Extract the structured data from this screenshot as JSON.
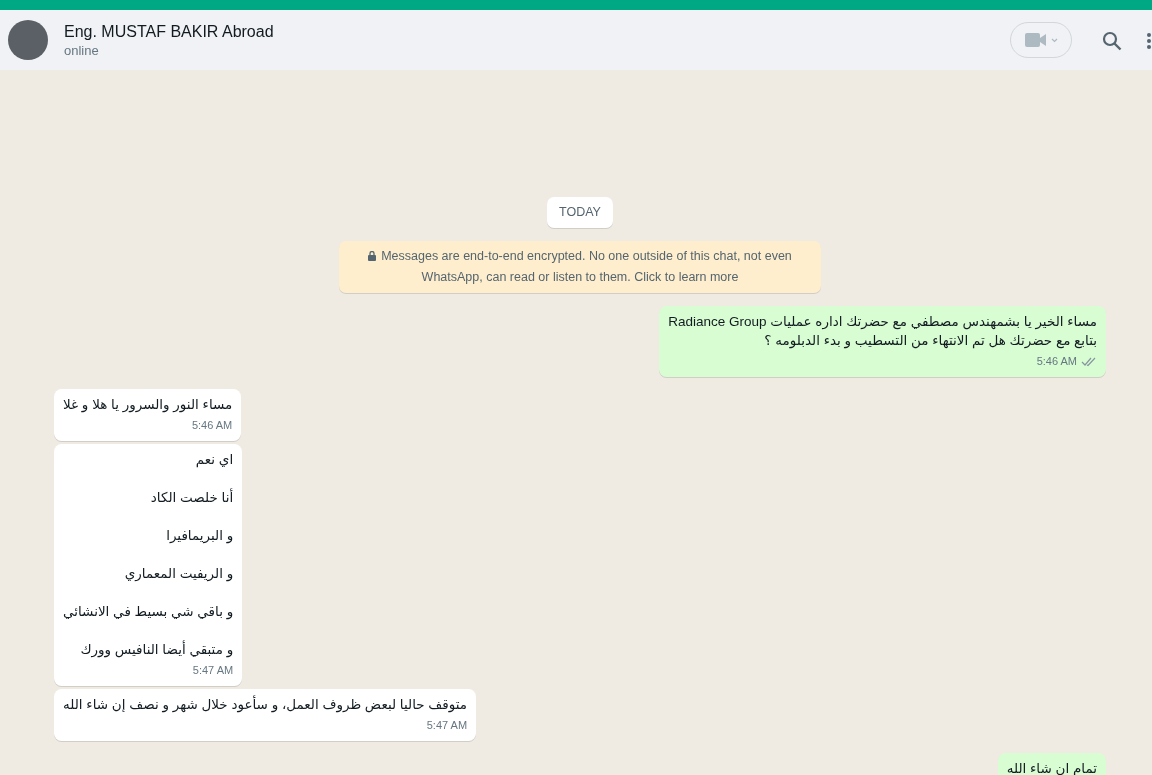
{
  "header": {
    "contact_name": "Eng. MUSTAF BAKIR Abroad",
    "status": "online"
  },
  "date_divider": "TODAY",
  "encryption_notice": "Messages are end-to-end encrypted. No one outside of this chat, not even WhatsApp, can read or listen to them. Click to learn more",
  "messages": [
    {
      "kind": "outgoing",
      "paragraphs": [
        [
          "مساء الخير يا بشمهندس مصطفي مع  حضرتك اداره عمليات Radiance Group",
          "بتابع مع حضرتك هل تم الانتهاء من التسطيب و بدء الدبلومه ؟"
        ]
      ],
      "time": "5:46 AM"
    },
    {
      "kind": "incoming",
      "paragraphs": [
        [
          "مساء النور والسرور يا هلا و غلا"
        ]
      ],
      "time": "5:46 AM"
    },
    {
      "kind": "incoming",
      "paragraphs": [
        [
          "اي نعم"
        ],
        [
          "أنا خلصت الكاد"
        ],
        [
          "و البريمافيرا"
        ],
        [
          "و الريفيت المعماري"
        ],
        [
          "و باقي شي بسيط في الانشائي"
        ],
        [
          "و متبقي أيضا النافيس وورك"
        ]
      ],
      "time": "5:47 AM"
    },
    {
      "kind": "incoming",
      "paragraphs": [
        [
          "متوقف حاليا لبعض ظروف العمل، و سأعود خلال شهر و نصف إن شاء الله"
        ]
      ],
      "time": "5:47 AM"
    },
    {
      "kind": "outgoing",
      "paragraphs": [
        [
          "تمام ان شاء الله"
        ]
      ]
    }
  ]
}
